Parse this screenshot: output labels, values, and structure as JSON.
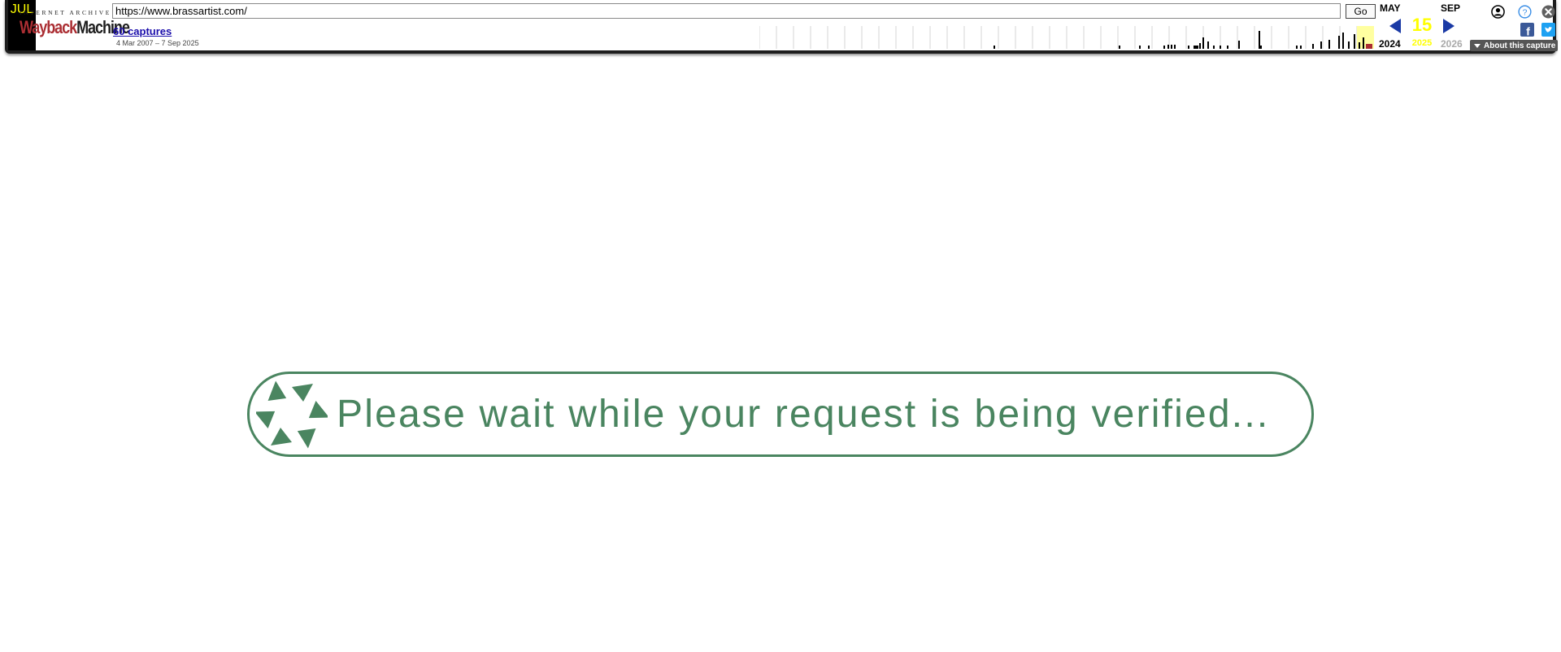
{
  "toolbar": {
    "logo_top": "INTERNET ARCHIVE",
    "logo_wayback": "Wayback",
    "logo_machine": "Machine",
    "url_value": "https://www.brassartist.com/",
    "go_label": "Go",
    "captures_label": "60 captures",
    "date_range": "4 Mar 2007 – 7 Sep 2025",
    "months": {
      "prev": "MAY",
      "current": "JUL",
      "next": "SEP"
    },
    "day": "15",
    "years": {
      "prev": "2024",
      "current": "2025",
      "next": "2026"
    },
    "about_label": "About this capture",
    "icons": [
      "user-icon",
      "help-icon",
      "close-icon",
      "facebook-icon",
      "twitter-icon"
    ],
    "colors": {
      "current_highlight": "#ffff00",
      "nav_arrow": "#1a3aa5",
      "link": "#1a0dab"
    }
  },
  "banner": {
    "message": "Please wait while your request is being verified...",
    "color": "#4a8560"
  }
}
